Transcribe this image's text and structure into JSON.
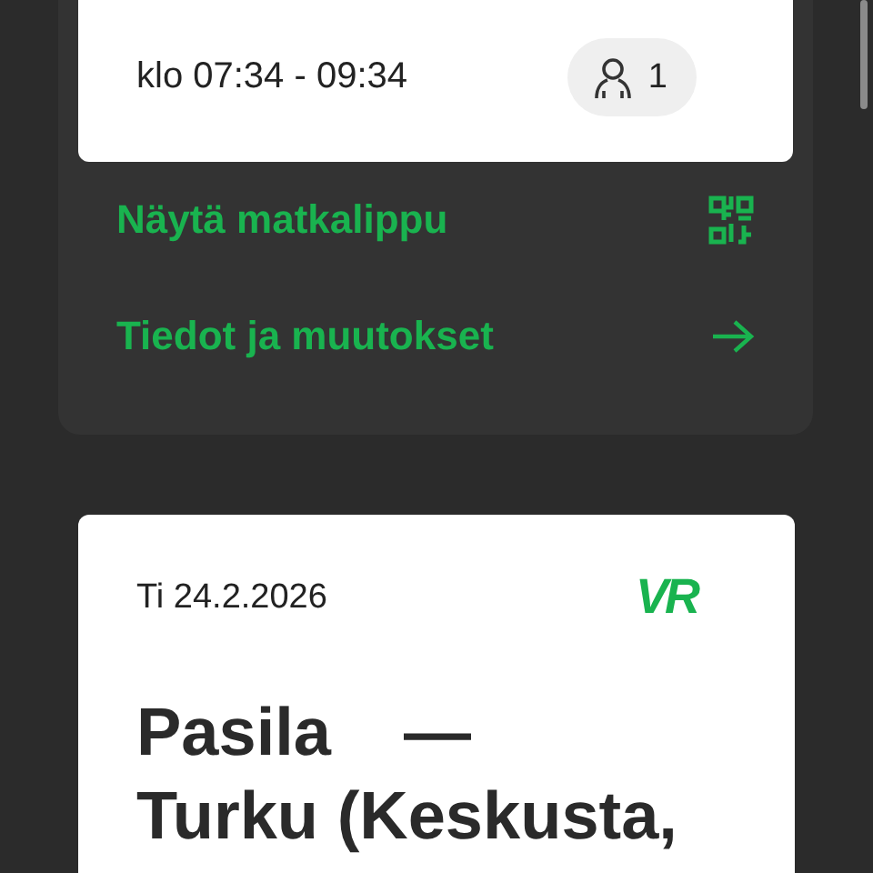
{
  "trip_card": {
    "time": "klo 07:34 - 09:34",
    "passengers": "1"
  },
  "actions": [
    {
      "label": "Näytä matkalippu",
      "kind": "qr"
    },
    {
      "label": "Tiedot ja muutokset",
      "kind": "arrow"
    }
  ],
  "next_trip": {
    "date": "Ti 24.2.2026",
    "logo": "VR",
    "origin": "Pasila",
    "separator": "—",
    "destination": "Turku (Keskusta,"
  }
}
